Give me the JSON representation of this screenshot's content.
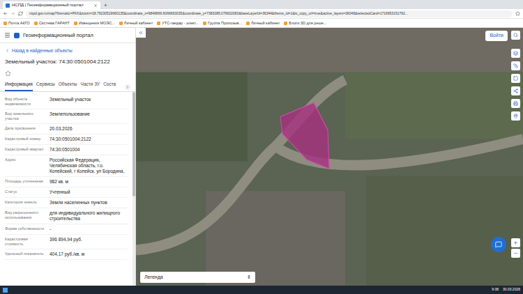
{
  "browser": {
    "tabs": [
      {
        "title": "НСПД | Геоинформационный портал",
        "selected": true
      }
    ],
    "new_tab": "+",
    "address": "nspd.gov.ru/map?thematic=PKK&zoom=18.79230519660135&coordinate_x=6849866.6066663035&coordinate_y=7383085.076602083&baseLayerId=36344&theme_id=1&is_copy_url=true&active_layers=36048&selectedCard=1716953151762...",
    "bookmarks": [
      "Почта АКГО",
      "Система ГАРАНТ",
      "Извещения МОЭС...",
      "Личный кабинет",
      "УТС-гандар - элект...",
      "Группа Пропозыв...",
      "Личный кабинет",
      "Блоги 3D для реше..."
    ]
  },
  "app": {
    "title": "Геоинформационный портал",
    "back": "Назад в найденные объекты",
    "heading": "Земельный участок: 74:30:0501004:2122",
    "tabs": [
      {
        "label": "Информация",
        "selected": true
      },
      {
        "label": "Сервисы",
        "selected": false
      },
      {
        "label": "Объекты",
        "selected": false
      },
      {
        "label": "Части ЗУ",
        "selected": false
      },
      {
        "label": "Соста",
        "selected": false
      }
    ],
    "properties": [
      {
        "label": "Вид объекта недвижимости",
        "value": "Земельный участок"
      },
      {
        "label": "Вид земельного участка",
        "value": "Землепользование"
      },
      {
        "label": "Дата присвоения",
        "value": "20.03.2026"
      },
      {
        "label": "Кадастровый номер",
        "value": "74:30:0501004:2122"
      },
      {
        "label": "Кадастровый квартал",
        "value": "74:30:0501004"
      },
      {
        "label": "Адрес",
        "value": "Российская Федерация, Челябинская область, г.о. Копейский, г Копейск, ул Бородина,"
      },
      {
        "label": "Площадь уточненная",
        "value": "982 кв. м"
      },
      {
        "label": "Статус",
        "value": "Учтенный"
      },
      {
        "label": "Категория земель",
        "value": "Земли населенных пунктов"
      },
      {
        "label": "Вид разрешенного использования",
        "value": "для индивидуального жилищного строительства"
      },
      {
        "label": "Форма собственности",
        "value": "-"
      },
      {
        "label": "Кадастровая стоимость",
        "value": "396 894,94 руб."
      },
      {
        "label": "Удельный показатель",
        "value": "404,17 руб./кв. м"
      }
    ],
    "login": "Войти",
    "legend": "Легенда",
    "legend_arrow": "⇕"
  },
  "taskbar": {
    "time": "9:38",
    "date": "30.03.2026"
  }
}
